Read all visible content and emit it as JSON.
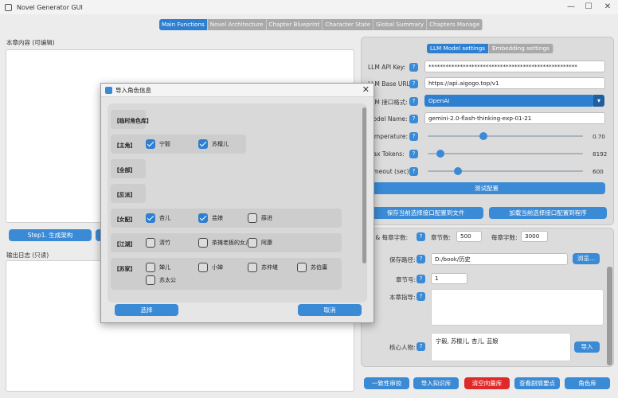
{
  "window": {
    "title": "Novel Generator GUI",
    "minimize": "—",
    "maximize": "☐",
    "close": "✕"
  },
  "tabs": [
    "Main Functions",
    "Novel Architecture",
    "Chapter Blueprint",
    "Character State",
    "Global Summary",
    "Chapters Manage"
  ],
  "left": {
    "chapter_content_label": "本章内容 (可编辑)",
    "step1_label": "Step1. 生成架构",
    "log_label": "输出日志 (只读)"
  },
  "config": {
    "subtabs": [
      "LLM Model settings",
      "Embedding settings"
    ],
    "api_key_label": "LLM API Key:",
    "api_key_value": "****************************************************",
    "base_url_label": "LLM Base URL:",
    "base_url_value": "https://api.aigogo.top/v1",
    "interface_label": "LLM 接口格式:",
    "interface_value": "OpenAI",
    "model_label": "Model Name:",
    "model_value": "gemini-2.0-flash-thinking-exp-01-21",
    "temperature_label": "Temperature:",
    "temperature_value": "0.70",
    "temperature_fraction": 0.35,
    "max_tokens_label": "Max Tokens:",
    "max_tokens_value": "8192",
    "max_tokens_fraction": 0.06,
    "timeout_label": "Timeout (sec):",
    "timeout_value": "600",
    "timeout_fraction": 0.18,
    "test_button": "测试配置",
    "save_button": "保存当前选择接口配置到文件",
    "load_button": "加载当前选择接口配置到程序",
    "help": "?"
  },
  "params": {
    "chapters_words_label": "章数 & 每章字数:",
    "chapters_label": "章节数:",
    "chapters_value": "500",
    "words_label": "每章字数:",
    "words_value": "3000",
    "save_path_label": "保存路径:",
    "save_path_value": "D:/book/历史",
    "browse_button": "浏览...",
    "chapter_no_label": "章节号:",
    "chapter_no_value": "1",
    "guide_label": "本章指导:",
    "core_chars_label": "核心人物:",
    "core_chars_value": "宁毅, 苏檀儿, 杏儿, 芸娘",
    "import_button": "导入"
  },
  "bottom_buttons": [
    "一致性审校",
    "导入知识库",
    "清空向量库",
    "查看剧情要点",
    "角色库"
  ],
  "dialog": {
    "title": "导入角色信息",
    "close": "✕",
    "groups": [
      {
        "label": "【临时角色库】",
        "items": []
      },
      {
        "label": "【主角】",
        "items": [
          {
            "name": "宁毅",
            "checked": true
          },
          {
            "name": "苏檀儿",
            "checked": true
          }
        ]
      },
      {
        "label": "【全部】",
        "items": []
      },
      {
        "label": "【反派】",
        "items": []
      },
      {
        "label": "【女配】",
        "items": [
          {
            "name": "杏儿",
            "checked": true
          },
          {
            "name": "芸娘",
            "checked": true
          },
          {
            "name": "薛进",
            "checked": false
          }
        ]
      },
      {
        "label": "【江湖】",
        "items": [
          {
            "name": "清竹",
            "checked": false
          },
          {
            "name": "茶摊老板的女儿",
            "checked": false
          },
          {
            "name": "阿康",
            "checked": false
          }
        ]
      },
      {
        "label": "【苏家】",
        "items": [
          {
            "name": "婵儿",
            "checked": false
          },
          {
            "name": "小婵",
            "checked": false
          },
          {
            "name": "苏仲堪",
            "checked": false
          },
          {
            "name": "苏伯庸",
            "checked": false
          },
          {
            "name": "苏太公",
            "checked": false
          }
        ]
      }
    ],
    "select_button": "选择",
    "cancel_button": "取消"
  },
  "colors": {
    "accent": "#3a8ad6",
    "danger": "#e02a2a",
    "tab_active": "#2f7fd0"
  }
}
